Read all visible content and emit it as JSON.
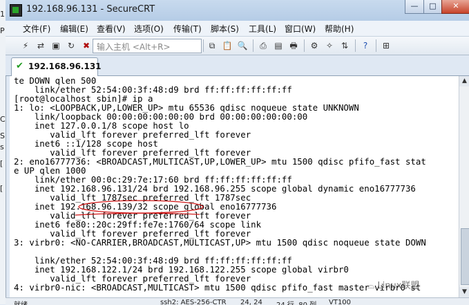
{
  "window": {
    "title": "192.168.96.131 - SecureCRT"
  },
  "left_strip": [
    "1",
    "P",
    "C",
    "S",
    "[",
    "s",
    "["
  ],
  "menu": [
    "文件(F)",
    "编辑(E)",
    "查看(V)",
    "选项(O)",
    "传输(T)",
    "脚本(S)",
    "工具(L)",
    "窗口(W)",
    "帮助(H)"
  ],
  "toolbar": {
    "host_placeholder": "输入主机 <Alt+R>"
  },
  "tab": {
    "label": "192.168.96.131"
  },
  "terminal": {
    "lines": [
      "te DOWN qlen 500",
      "    link/ether 52:54:00:3f:48:d9 brd ff:ff:ff:ff:ff:ff",
      "[root@localhost sbin]# ip a",
      "1: lo: <LOOPBACK,UP,LOWER_UP> mtu 65536 qdisc noqueue state UNKNOWN",
      "    link/loopback 00:00:00:00:00:00 brd 00:00:00:00:00:00",
      "    inet 127.0.0.1/8 scope host lo",
      "       valid_lft forever preferred_lft forever",
      "    inet6 ::1/128 scope host",
      "       valid_lft forever preferred_lft forever",
      "2: eno16777736: <BROADCAST,MULTICAST,UP,LOWER_UP> mtu 1500 qdisc pfifo_fast stat",
      "e UP qlen 1000",
      "    link/ether 00:0c:29:7e:17:60 brd ff:ff:ff:ff:ff:ff",
      "    inet 192.168.96.131/24 brd 192.168.96.255 scope global dynamic eno16777736",
      "       valid_lft 1787sec preferred_lft 1787sec",
      "    inet 192.168.96.139/32 scope global eno16777736",
      "       valid_lft forever preferred_lft forever",
      "    inet6 fe80::20c:29ff:fe7e:1760/64 scope link",
      "       valid_lft forever preferred_lft forever",
      "3: virbr0: <NO-CARRIER,BROADCAST,MULTICAST,UP> mtu 1500 qdisc noqueue state DOWN",
      "",
      "    link/ether 52:54:00:3f:48:d9 brd ff:ff:ff:ff:ff:ff",
      "    inet 192.168.122.1/24 brd 192.168.122.255 scope global virbr0",
      "       valid_lft forever preferred_lft forever",
      "4: virbr0-nic: <BROADCAST,MULTICAST> mtu 1500 qdisc pfifo_fast master virbr0 st"
    ]
  },
  "statusbar": [
    "就绪",
    "ssh2: AES-256-CTR",
    "24,  24",
    "24 行, 80 列",
    "VT100"
  ],
  "watermark": "Linux联盟",
  "colors": {
    "annotation": "#d01818",
    "accent_check": "#1e9a1e"
  }
}
